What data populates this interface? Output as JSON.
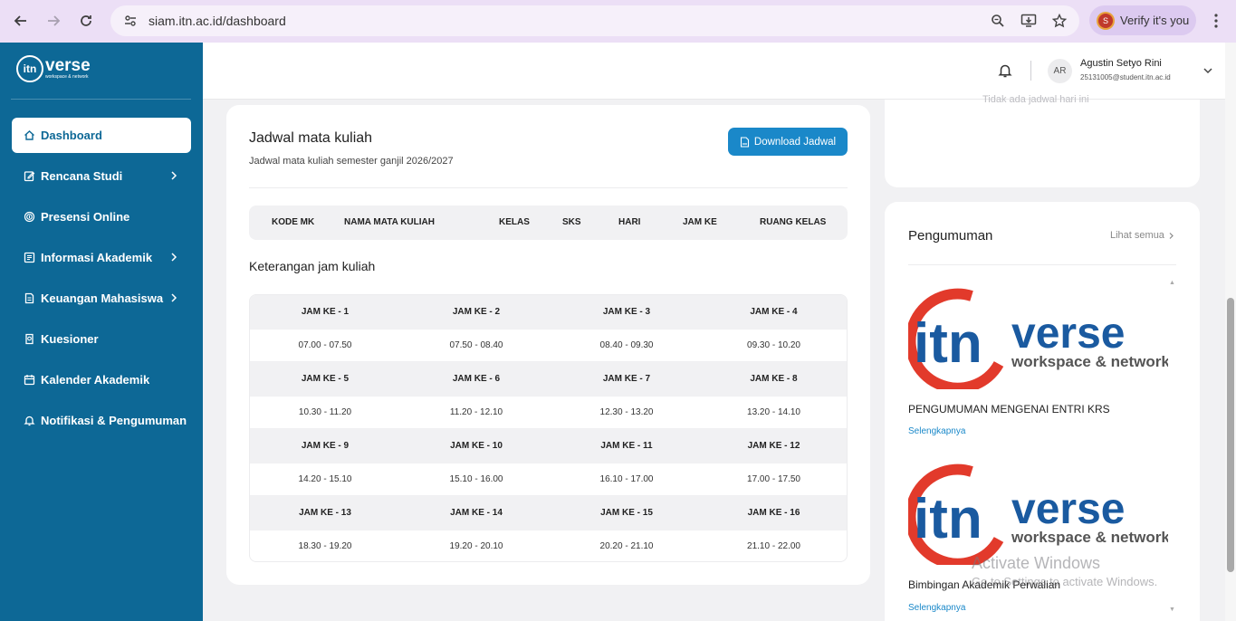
{
  "browser": {
    "url": "siam.itn.ac.id/dashboard",
    "verify_label": "Verify it's you",
    "verify_badge": "S"
  },
  "sidebar": {
    "logo_mark": "itn",
    "logo_text": "verse",
    "logo_sub": "workspace & network",
    "items": [
      {
        "label": "Dashboard",
        "icon": "home-icon",
        "active": true,
        "has_chevron": false
      },
      {
        "label": "Rencana Studi",
        "icon": "edit-icon",
        "active": false,
        "has_chevron": true
      },
      {
        "label": "Presensi Online",
        "icon": "fingerprint-icon",
        "active": false,
        "has_chevron": false
      },
      {
        "label": "Informasi Akademik",
        "icon": "info-board-icon",
        "active": false,
        "has_chevron": true
      },
      {
        "label": "Keuangan Mahasiswa",
        "icon": "document-icon",
        "active": false,
        "has_chevron": true
      },
      {
        "label": "Kuesioner",
        "icon": "questionnaire-icon",
        "active": false,
        "has_chevron": false
      },
      {
        "label": "Kalender Akademik",
        "icon": "calendar-icon",
        "active": false,
        "has_chevron": false
      },
      {
        "label": "Notifikasi & Pengumuman",
        "icon": "bell-icon",
        "active": false,
        "has_chevron": false
      }
    ]
  },
  "header": {
    "avatar_initials": "AR",
    "user_name": "Agustin Setyo Rini",
    "user_email": "25131005@student.itn.ac.id"
  },
  "schedule": {
    "title": "Jadwal mata kuliah",
    "subtitle": "Jadwal mata kuliah semester ganjil 2026/2027",
    "download_label": "Download Jadwal",
    "columns": [
      "KODE MK",
      "NAMA MATA KULIAH",
      "KELAS",
      "SKS",
      "HARI",
      "JAM KE",
      "RUANG KELAS"
    ]
  },
  "jam": {
    "title": "Keterangan jam kuliah",
    "rows": [
      {
        "labels": [
          "JAM KE - 1",
          "JAM KE - 2",
          "JAM KE - 3",
          "JAM KE - 4"
        ],
        "times": [
          "07.00 - 07.50",
          "07.50 - 08.40",
          "08.40 - 09.30",
          "09.30 - 10.20"
        ]
      },
      {
        "labels": [
          "JAM KE - 5",
          "JAM KE - 6",
          "JAM KE - 7",
          "JAM KE - 8"
        ],
        "times": [
          "10.30 - 11.20",
          "11.20 - 12.10",
          "12.30 - 13.20",
          "13.20 - 14.10"
        ]
      },
      {
        "labels": [
          "JAM KE - 9",
          "JAM KE - 10",
          "JAM KE - 11",
          "JAM KE - 12"
        ],
        "times": [
          "14.20 - 15.10",
          "15.10 - 16.00",
          "16.10 - 17.00",
          "17.00 - 17.50"
        ]
      },
      {
        "labels": [
          "JAM KE - 13",
          "JAM KE - 14",
          "JAM KE - 15",
          "JAM KE - 16"
        ],
        "times": [
          "18.30 - 19.20",
          "19.20 - 20.10",
          "20.20 - 21.10",
          "21.10 - 22.00"
        ]
      }
    ]
  },
  "right_top": {
    "empty_text": "Tidak ada jadwal hari ini"
  },
  "announcements": {
    "title": "Pengumuman",
    "see_all": "Lihat semua",
    "items": [
      {
        "image_mark": "itn",
        "image_text": "verse",
        "image_sub": "workspace & network",
        "title": "PENGUMUMAN MENGENAI ENTRI KRS",
        "link": "Selengkapnya"
      },
      {
        "image_mark": "itn",
        "image_text": "verse",
        "image_sub": "workspace & network",
        "title": "Bimbingan Akademik Perwalian",
        "link": "Selengkapnya"
      }
    ]
  },
  "watermark": {
    "line1": "Activate Windows",
    "line2": "Go to Settings to activate Windows."
  },
  "colors": {
    "sidebar_bg": "#0d6896",
    "accent": "#1a88c9",
    "logo_red": "#e23a2b",
    "logo_blue": "#1a5aa0"
  }
}
